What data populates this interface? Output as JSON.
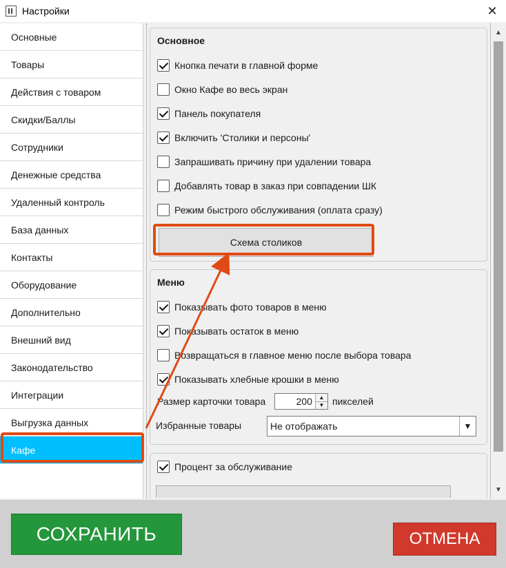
{
  "window": {
    "title": "Настройки",
    "icon": "app-grid-icon",
    "close_glyph": "✕"
  },
  "sidebar": {
    "items": [
      {
        "label": "Основные"
      },
      {
        "label": "Товары"
      },
      {
        "label": "Действия с товаром"
      },
      {
        "label": "Скидки/Баллы"
      },
      {
        "label": "Сотрудники"
      },
      {
        "label": "Денежные средства"
      },
      {
        "label": "Удаленный контроль"
      },
      {
        "label": "База данных"
      },
      {
        "label": "Контакты"
      },
      {
        "label": "Оборудование"
      },
      {
        "label": "Дополнительно"
      },
      {
        "label": "Внешний вид"
      },
      {
        "label": "Законодательство"
      },
      {
        "label": "Интеграции"
      },
      {
        "label": "Выгрузка данных"
      },
      {
        "label": "Кафе",
        "active": true
      }
    ],
    "active_color": "#00bfff"
  },
  "main": {
    "group_basic": {
      "title": "Основное",
      "options": [
        {
          "label": "Кнопка печати в главной форме",
          "checked": true
        },
        {
          "label": "Окно Кафе во весь экран",
          "checked": false
        },
        {
          "label": "Панель покупателя",
          "checked": true
        },
        {
          "label": "Включить 'Столики и персоны'",
          "checked": true
        },
        {
          "label": "Запрашивать причину при удалении товара",
          "checked": false
        },
        {
          "label": "Добавлять товар в заказ при совпадении ШК",
          "checked": false
        },
        {
          "label": "Режим быстрого обслуживания (оплата сразу)",
          "checked": false
        }
      ],
      "scheme_button": "Схема столиков"
    },
    "group_menu": {
      "title": "Меню",
      "options": [
        {
          "label": "Показывать фото товаров в меню",
          "checked": true
        },
        {
          "label": "Показывать остаток в меню",
          "checked": true
        },
        {
          "label": "Возвращаться в главное меню после выбора товара",
          "checked": false
        },
        {
          "label": "Показывать хлебные крошки в меню",
          "checked": true
        }
      ],
      "card_size_label": "Размер карточки товара",
      "card_size_value": "200",
      "card_size_unit": "пикселей",
      "favorites_label": "Избранные товары",
      "favorites_value": "Не отображать"
    },
    "group_service": {
      "option": {
        "label": "Процент за обслуживание",
        "checked": true
      }
    }
  },
  "footer": {
    "save_label": "СОХРАНИТЬ",
    "cancel_label": "ОТМЕНА",
    "save_color": "#24973c",
    "cancel_color": "#d0392b"
  },
  "annotation_color": "#e04a14"
}
